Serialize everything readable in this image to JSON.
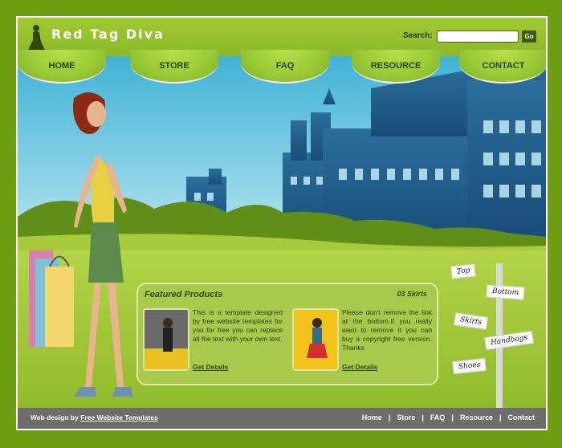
{
  "brand": {
    "name": "Red Tag Diva"
  },
  "search": {
    "label": "Search:",
    "value": "",
    "button": "Go"
  },
  "nav": {
    "items": [
      {
        "label": "HOME"
      },
      {
        "label": "STORE"
      },
      {
        "label": "FAQ"
      },
      {
        "label": "RESOURCE"
      },
      {
        "label": "CONTACT"
      }
    ]
  },
  "featured": {
    "title": "Featured Products",
    "count": "03 Skirts",
    "products": [
      {
        "text": "This is a template designed by free website templates for you for free you can replace all the text with your own text.",
        "link": "Get Details"
      },
      {
        "text": "Please don't remove the link at the bottom.If you really want to remove it you can buy a copyright free version. Thanks",
        "link": "Get Details"
      }
    ]
  },
  "signpost": {
    "items": [
      {
        "label": "Top"
      },
      {
        "label": "Bottom"
      },
      {
        "label": "Skirts"
      },
      {
        "label": "Handbags"
      },
      {
        "label": "Shoes"
      }
    ]
  },
  "footer": {
    "credit_prefix": "Web design by",
    "credit_link": "Free Website Templates",
    "links": [
      {
        "label": "Home"
      },
      {
        "label": "Store"
      },
      {
        "label": "FAQ"
      },
      {
        "label": "Resource"
      },
      {
        "label": "Contact"
      }
    ],
    "separator": "|"
  },
  "colors": {
    "frame": "#6e9d12",
    "header": "#9fca30",
    "nav_text": "#26420a",
    "footer": "#6d6d6d",
    "sky": "#3fb8d8"
  }
}
